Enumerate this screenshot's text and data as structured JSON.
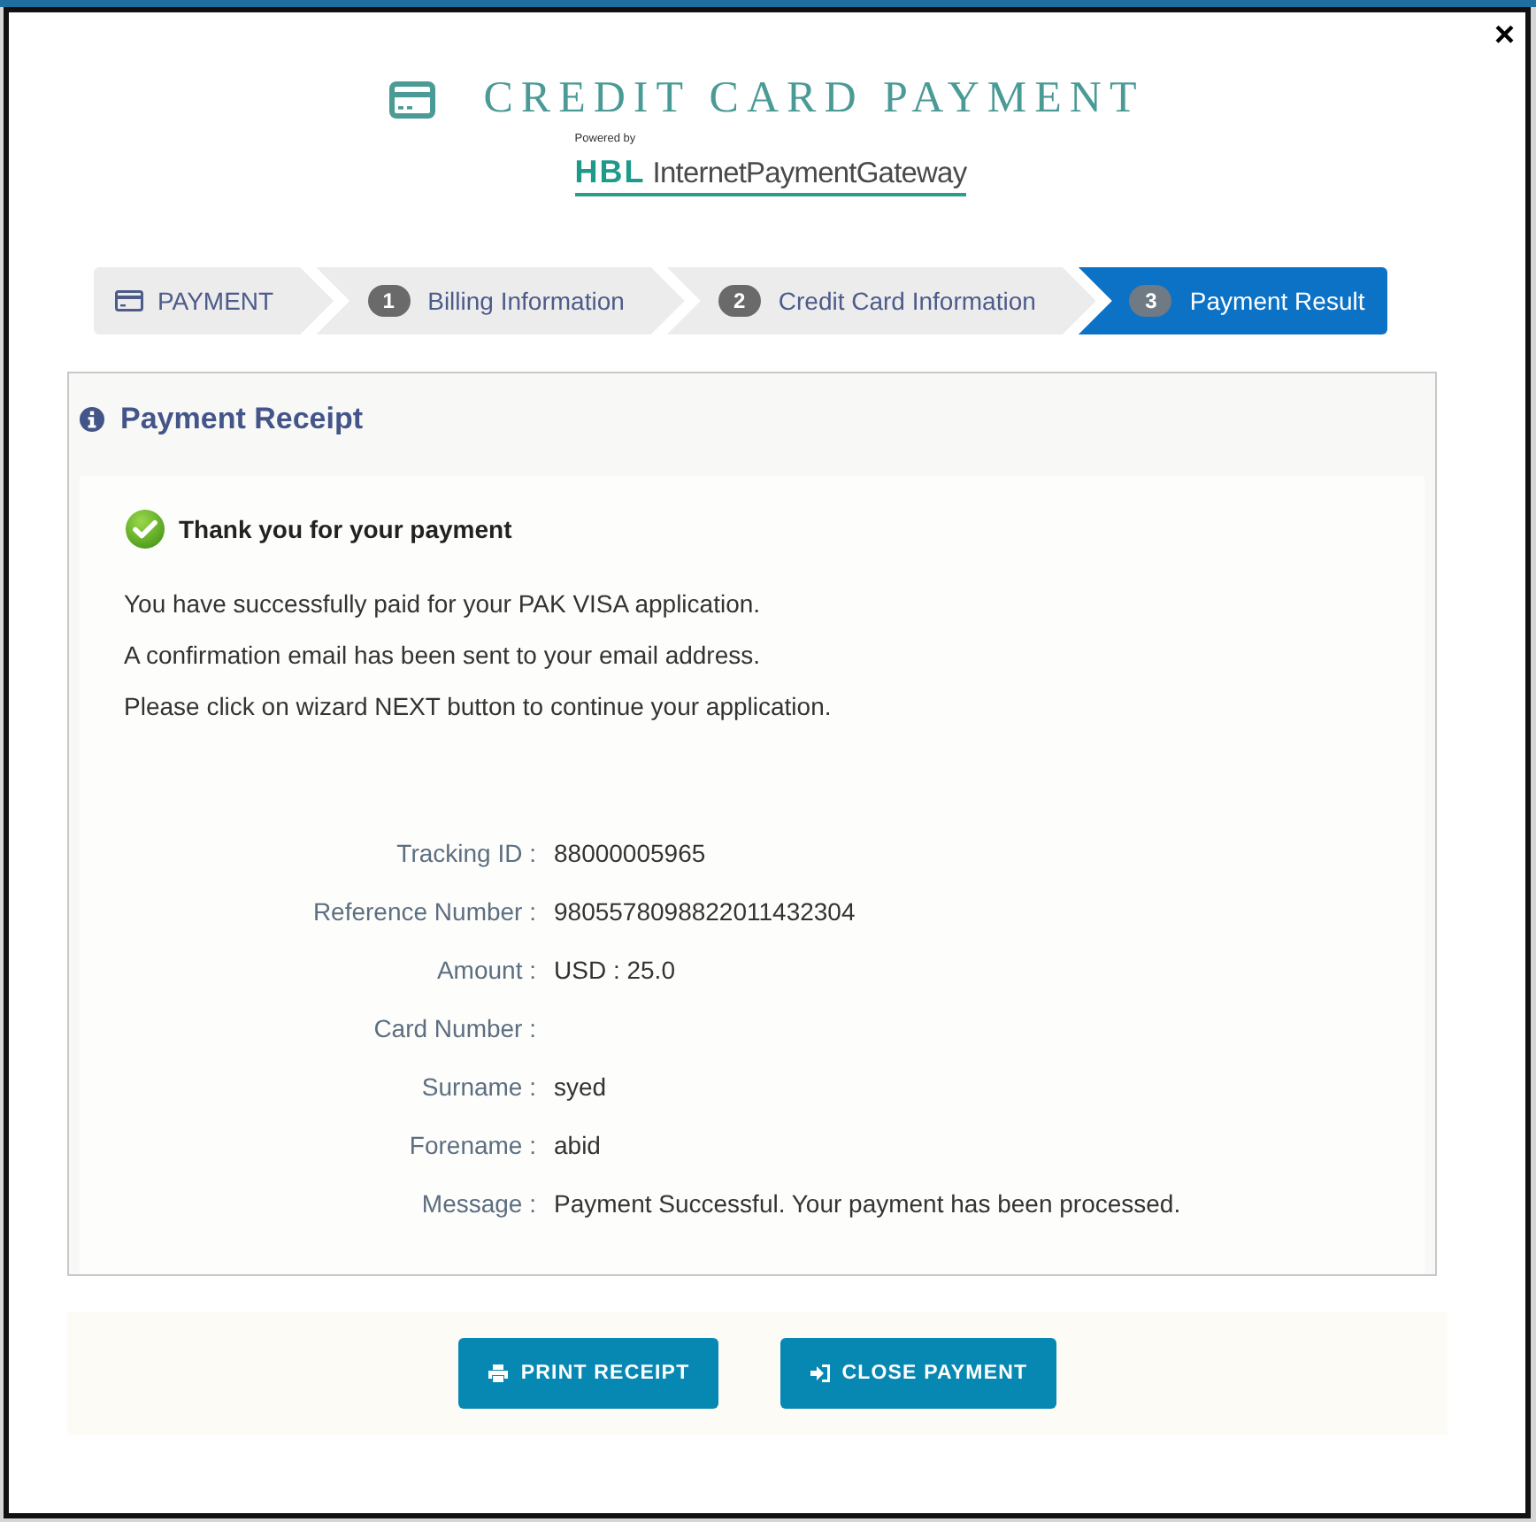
{
  "window": {
    "close": "×"
  },
  "header": {
    "title": "CREDIT CARD PAYMENT",
    "powered_by": "Powered by",
    "logo_mark": "HBL",
    "logo_text": "InternetPaymentGateway"
  },
  "steps": [
    {
      "kind": "icon",
      "label": "PAYMENT",
      "selected": false
    },
    {
      "kind": "numbered",
      "number": "1",
      "label": "Billing Information",
      "selected": false
    },
    {
      "kind": "numbered",
      "number": "2",
      "label": "Credit Card Information",
      "selected": false
    },
    {
      "kind": "numbered",
      "number": "3",
      "label": "Payment Result",
      "selected": true
    }
  ],
  "receipt": {
    "title": "Payment Receipt",
    "success_heading": "Thank you for your payment",
    "messages": [
      "You have successfully paid for your PAK VISA application.",
      "A confirmation email has been sent to your email address.",
      "Please click on wizard NEXT button to continue your application."
    ],
    "details": [
      {
        "label": "Tracking ID :",
        "value": "88000005965"
      },
      {
        "label": "Reference Number :",
        "value": "9805578098822011432304"
      },
      {
        "label": "Amount :",
        "value": "USD : 25.0"
      },
      {
        "label": "Card Number :"
      },
      {
        "label": "Surname :",
        "value": "syed"
      },
      {
        "label": "Forename :",
        "value": "abid"
      },
      {
        "label": "Message :",
        "value": "Payment Successful. Your payment has been processed."
      }
    ]
  },
  "buttons": [
    {
      "kind": "print",
      "label": "PRINT RECEIPT"
    },
    {
      "kind": "close",
      "label": "CLOSE PAYMENT"
    }
  ]
}
